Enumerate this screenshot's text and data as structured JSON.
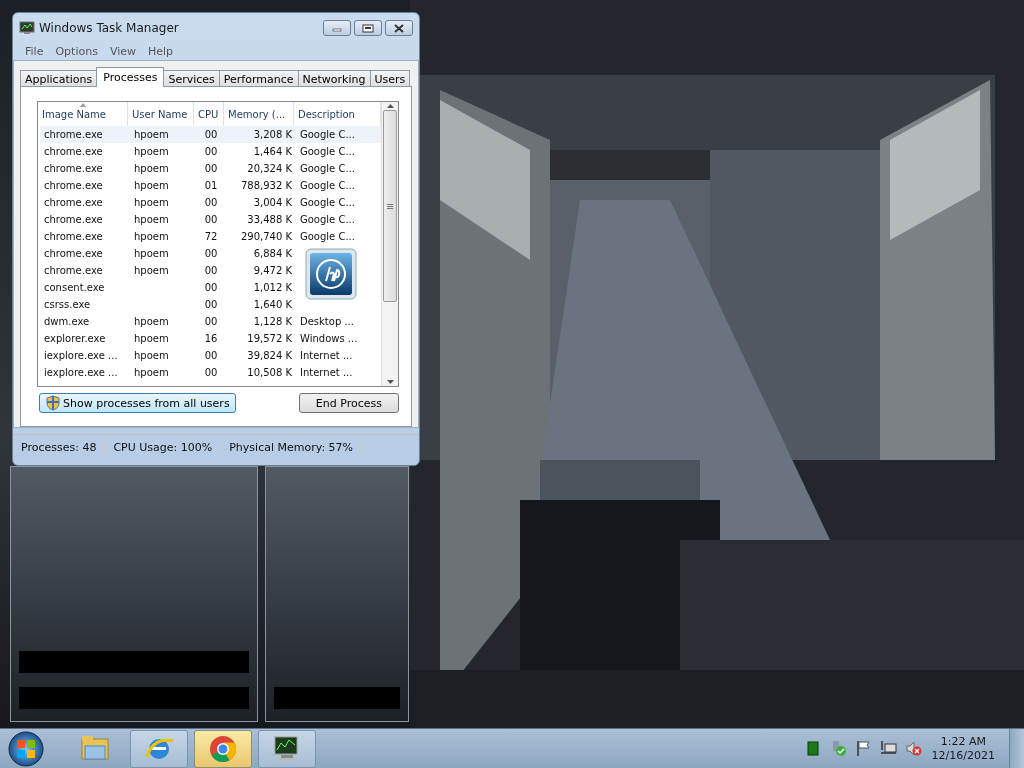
{
  "window": {
    "title": "Windows Task Manager"
  },
  "menu": [
    "File",
    "Options",
    "View",
    "Help"
  ],
  "tabs": [
    {
      "label": "Applications",
      "selected": false
    },
    {
      "label": "Processes",
      "selected": true
    },
    {
      "label": "Services",
      "selected": false
    },
    {
      "label": "Performance",
      "selected": false
    },
    {
      "label": "Networking",
      "selected": false
    },
    {
      "label": "Users",
      "selected": false
    }
  ],
  "table": {
    "columns": [
      {
        "label": "Image Name",
        "sorted": true
      },
      {
        "label": "User Name",
        "sorted": false
      },
      {
        "label": "CPU",
        "sorted": false
      },
      {
        "label": "Memory (...",
        "sorted": false
      },
      {
        "label": "Description",
        "sorted": false
      }
    ],
    "rows": [
      {
        "image_name": "chrome.exe",
        "user_name": "hpoem",
        "cpu": "00",
        "memory": "3,208 K",
        "description": "Google C...",
        "selected": true
      },
      {
        "image_name": "chrome.exe",
        "user_name": "hpoem",
        "cpu": "00",
        "memory": "1,464 K",
        "description": "Google C...",
        "selected": false
      },
      {
        "image_name": "chrome.exe",
        "user_name": "hpoem",
        "cpu": "00",
        "memory": "20,324 K",
        "description": "Google C...",
        "selected": false
      },
      {
        "image_name": "chrome.exe",
        "user_name": "hpoem",
        "cpu": "01",
        "memory": "788,932 K",
        "description": "Google C...",
        "selected": false
      },
      {
        "image_name": "chrome.exe",
        "user_name": "hpoem",
        "cpu": "00",
        "memory": "3,004 K",
        "description": "Google C...",
        "selected": false
      },
      {
        "image_name": "chrome.exe",
        "user_name": "hpoem",
        "cpu": "00",
        "memory": "33,488 K",
        "description": "Google C...",
        "selected": false
      },
      {
        "image_name": "chrome.exe",
        "user_name": "hpoem",
        "cpu": "72",
        "memory": "290,740 K",
        "description": "Google C...",
        "selected": false
      },
      {
        "image_name": "chrome.exe",
        "user_name": "hpoem",
        "cpu": "00",
        "memory": "6,884 K",
        "selected": false
      },
      {
        "image_name": "chrome.exe",
        "user_name": "hpoem",
        "cpu": "00",
        "memory": "9,472 K",
        "selected": false
      },
      {
        "image_name": "consent.exe",
        "cpu": "00",
        "memory": "1,012 K",
        "selected": false
      },
      {
        "image_name": "csrss.exe",
        "cpu": "00",
        "memory": "1,640 K",
        "selected": false
      },
      {
        "image_name": "dwm.exe",
        "user_name": "hpoem",
        "cpu": "00",
        "memory": "1,128 K",
        "description": "Desktop ...",
        "selected": false
      },
      {
        "image_name": "explorer.exe",
        "user_name": "hpoem",
        "cpu": "16",
        "memory": "19,572 K",
        "description": "Windows ...",
        "selected": false
      },
      {
        "image_name": "iexplore.exe ...",
        "user_name": "hpoem",
        "cpu": "00",
        "memory": "39,824 K",
        "description": "Internet ...",
        "selected": false
      },
      {
        "image_name": "iexplore.exe ...",
        "user_name": "hpoem",
        "cpu": "00",
        "memory": "10,508 K",
        "description": "Internet ...",
        "selected": false
      }
    ]
  },
  "buttons": [
    {
      "label": "Show processes from all users",
      "kind": "shield"
    },
    {
      "label": "End Process",
      "kind": "plain"
    }
  ],
  "status_bar": [
    "Processes: 48",
    "CPU Usage: 100%",
    "Physical Memory: 57%"
  ],
  "taskbar": {
    "items": [
      {
        "kind": "folder",
        "active": false
      },
      {
        "kind": "ie",
        "active": false
      },
      {
        "kind": "chrome",
        "active": true
      },
      {
        "kind": "taskmgr",
        "active": false
      }
    ],
    "tray": [
      {
        "kind": "green"
      },
      {
        "kind": "shield"
      },
      {
        "kind": "flag"
      },
      {
        "kind": "network"
      },
      {
        "kind": "speaker"
      }
    ],
    "time": "1:22 AM",
    "date": "12/16/2021"
  }
}
